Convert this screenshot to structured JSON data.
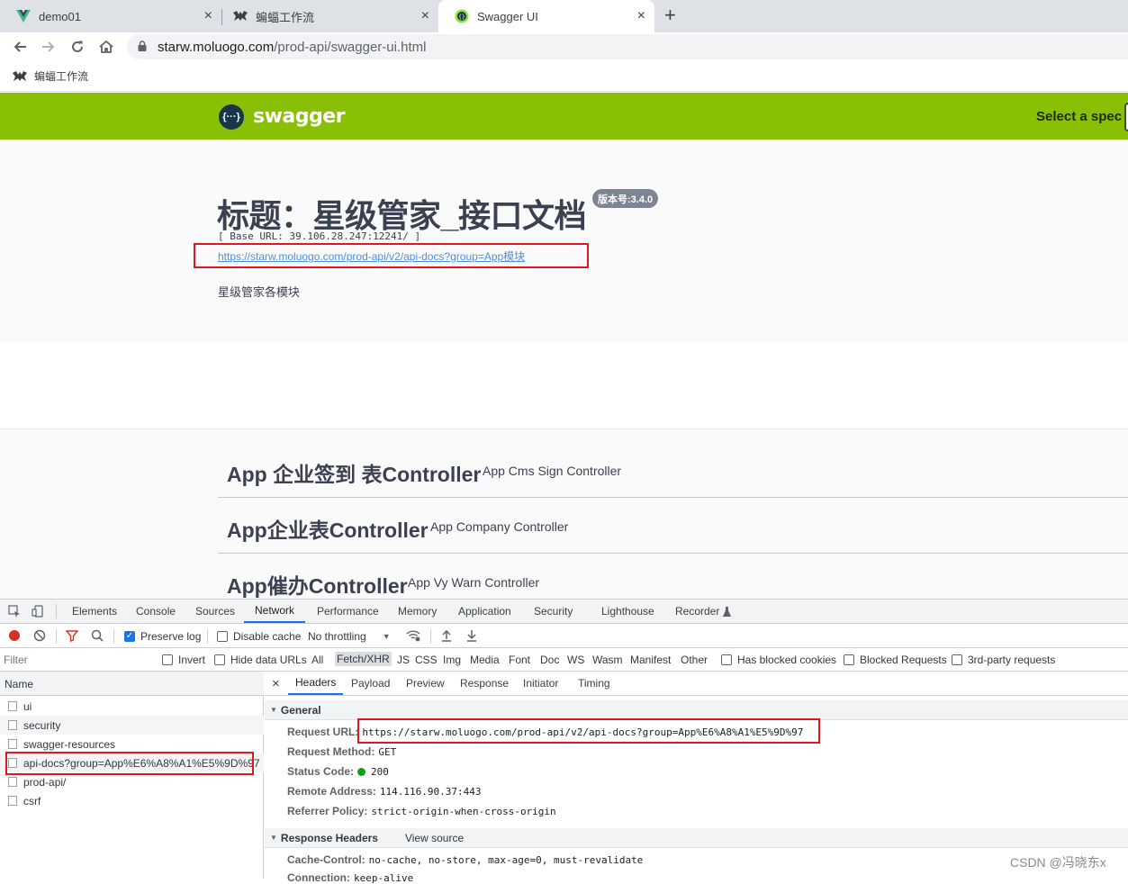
{
  "browser": {
    "tabs": [
      {
        "label": "demo01",
        "icon": "vue-icon",
        "active": false
      },
      {
        "label": "蝙蝠工作流",
        "icon": "bat-icon",
        "active": false
      },
      {
        "label": "Swagger UI",
        "icon": "swagger-icon",
        "active": true
      }
    ],
    "close_glyph": "×",
    "new_tab_glyph": "+",
    "url_host": "starw.moluogo.com",
    "url_path": "/prod-api/swagger-ui.html",
    "bookmark": "蝙蝠工作流"
  },
  "swagger": {
    "brand": "swagger",
    "logo_glyph": "{···}",
    "select_spec": "Select a spec",
    "title": "标题：星级管家_接口文档",
    "version": "版本号:3.4.0",
    "base_url": "[ Base URL: 39.106.28.247:12241/ ]",
    "docs_link": "https://starw.moluogo.com/prod-api/v2/api-docs?group=App模块",
    "description": "星级管家各模块",
    "controllers": [
      {
        "name": "App 企业签到 表Controller",
        "desc": "App Cms Sign Controller"
      },
      {
        "name": "App企业表Controller",
        "desc": "App Company Controller"
      },
      {
        "name": "App催办Controller",
        "desc": "App Vy Warn Controller"
      }
    ]
  },
  "devtools": {
    "tabs": [
      "Elements",
      "Console",
      "Sources",
      "Network",
      "Performance",
      "Memory",
      "Application",
      "Security",
      "Lighthouse",
      "Recorder"
    ],
    "active_tab": "Network",
    "toolbar": {
      "preserve_log": "Preserve log",
      "disable_cache": "Disable cache",
      "throttling": "No throttling"
    },
    "filter": {
      "placeholder": "Filter",
      "invert": "Invert",
      "hide_data_urls": "Hide data URLs",
      "types": [
        "All",
        "Fetch/XHR",
        "JS",
        "CSS",
        "Img",
        "Media",
        "Font",
        "Doc",
        "WS",
        "Wasm",
        "Manifest",
        "Other"
      ],
      "selected_type": "Fetch/XHR",
      "has_blocked_cookies": "Has blocked cookies",
      "blocked_requests": "Blocked Requests",
      "third_party": "3rd-party requests"
    },
    "requests_header": "Name",
    "requests": [
      "ui",
      "security",
      "swagger-resources",
      "api-docs?group=App%E6%A8%A1%E5%9D%97",
      "prod-api/",
      "csrf"
    ],
    "detail_tabs": [
      "Headers",
      "Payload",
      "Preview",
      "Response",
      "Initiator",
      "Timing"
    ],
    "active_detail_tab": "Headers",
    "general": {
      "title": "General",
      "request_url_label": "Request URL:",
      "request_url": "https://starw.moluogo.com/prod-api/v2/api-docs?group=App%E6%A8%A1%E5%9D%97",
      "method_label": "Request Method:",
      "method": "GET",
      "status_label": "Status Code:",
      "status": "200",
      "remote_label": "Remote Address:",
      "remote": "114.116.90.37:443",
      "referrer_label": "Referrer Policy:",
      "referrer": "strict-origin-when-cross-origin"
    },
    "response_headers": {
      "title": "Response Headers",
      "view_source": "View source",
      "cache_label": "Cache-Control:",
      "cache": "no-cache, no-store, max-age=0, must-revalidate",
      "connection_label": "Connection:",
      "connection": "keep-alive"
    }
  },
  "watermark": "CSDN @冯晓东x",
  "colors": {
    "swagger_green": "#89bf04",
    "highlight_red": "#e0171f",
    "devtools_blue": "#1a73e8"
  }
}
